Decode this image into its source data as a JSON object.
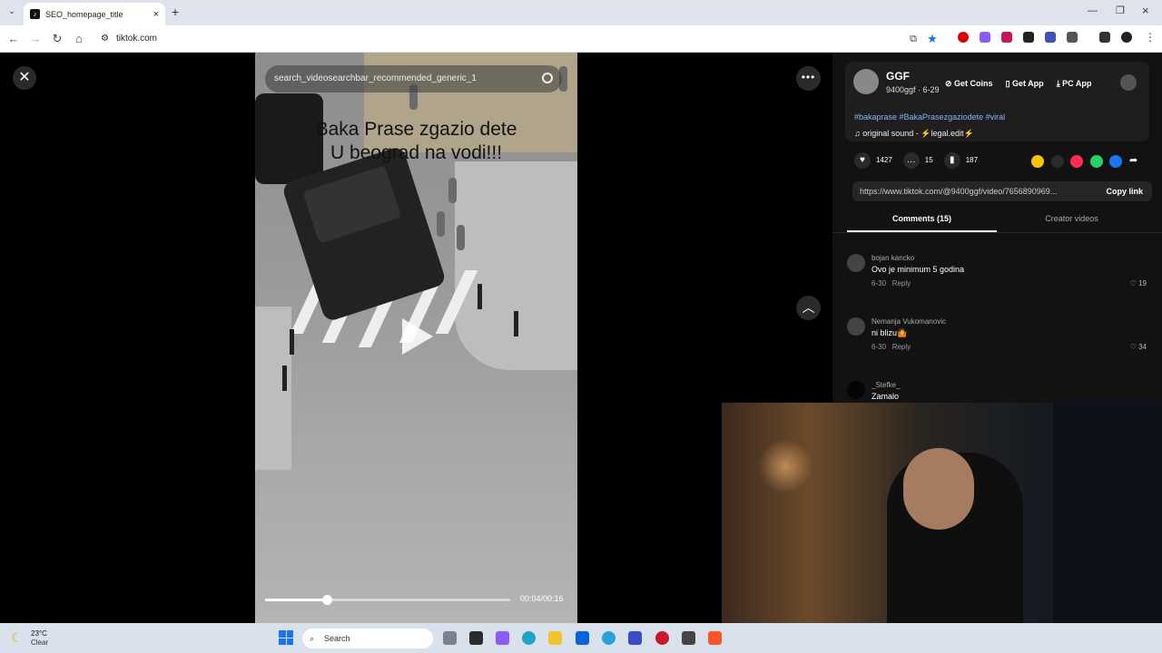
{
  "browser": {
    "tab_title": "SEO_homepage_title",
    "tab_favicon": "tiktok-icon",
    "url": "tiktok.com"
  },
  "video": {
    "search_placeholder": "search_videosearchbar_recommended_generic_1",
    "caption_line1": "Baka Prase zgazio dete",
    "caption_line2": "U beograd na vodi!!!",
    "time": "00:04/00:16",
    "progress_fraction": 0.25
  },
  "creator": {
    "name": "GGF",
    "handle": "9400ggf · 6-29",
    "hashtags": "#bakaprase #BakaPrasezgaziodete #viral",
    "sound": "original sound - ⚡legal.edit⚡"
  },
  "header_actions": {
    "get_coins": "Get Coins",
    "get_app": "Get App",
    "pc_app": "PC App"
  },
  "stats": {
    "likes": "1427",
    "comments": "15",
    "saves": "187"
  },
  "share": {
    "link": "https://www.tiktok.com/@9400ggf/video/7656890969...",
    "copy_label": "Copy link"
  },
  "tabs": {
    "comments": "Comments (15)",
    "creator_videos": "Creator videos"
  },
  "comments": [
    {
      "user": "bojan kancko",
      "text": "Ovo je minimum 5 godina",
      "date": "6-30",
      "reply": "Reply",
      "likes": "19"
    },
    {
      "user": "Nemanja Vukomanovic",
      "text": "ni blizu🤷",
      "date": "6-30",
      "reply": "Reply",
      "likes": "34"
    },
    {
      "user": "_Stefke_",
      "text": "Zamalo",
      "date": "",
      "reply": "",
      "likes": ""
    }
  ],
  "taskbar": {
    "temperature": "23°C",
    "condition": "Clear",
    "search_label": "Search"
  },
  "colors": {
    "hashtag": "#8ab4f8",
    "accent_like": "#fe2c55",
    "taskbar": "#d9e1ec"
  }
}
